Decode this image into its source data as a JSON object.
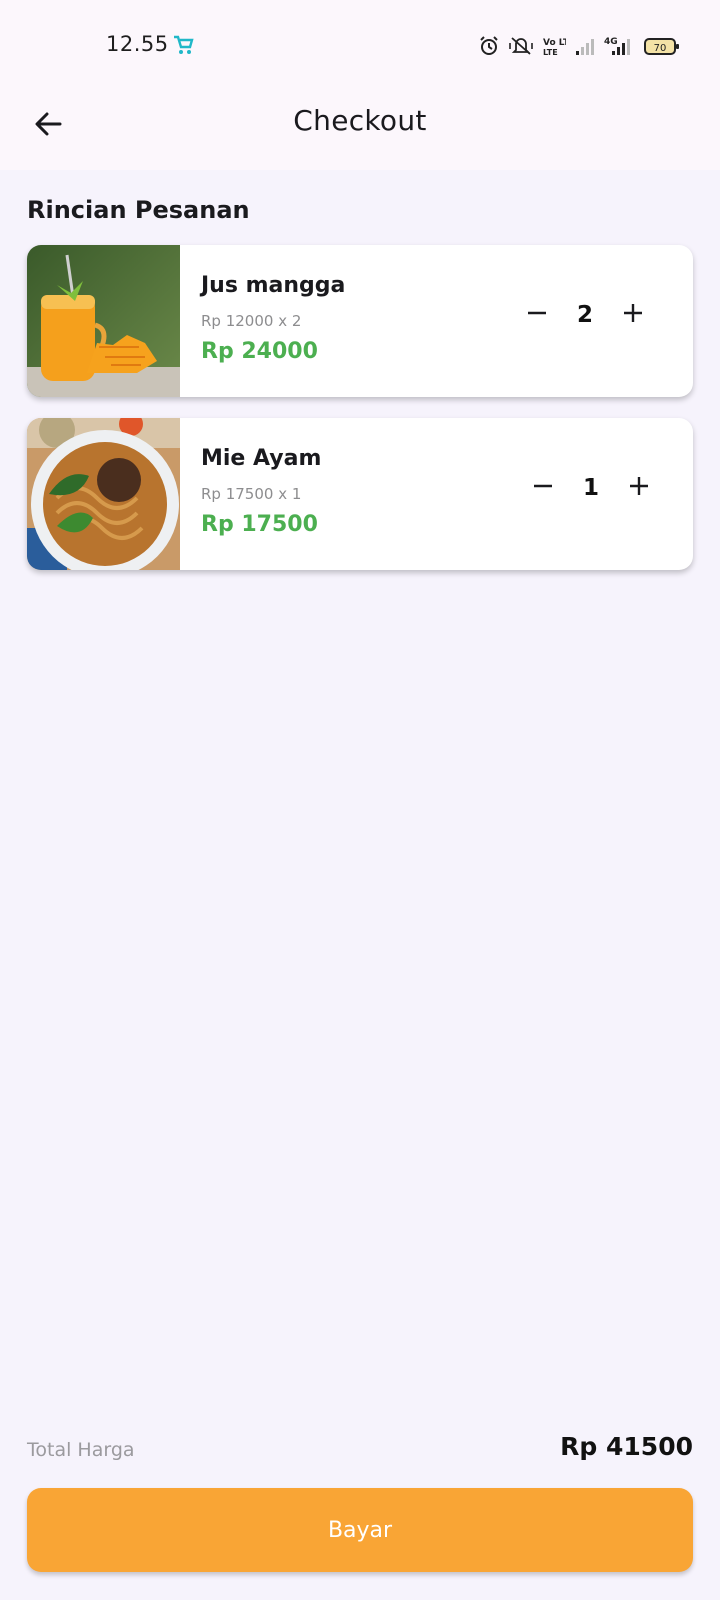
{
  "status_bar": {
    "time": "12.55",
    "battery": "70",
    "network": "4G",
    "volte": "Vo LTE",
    "icons": [
      "alarm-icon",
      "vibrate-off-icon",
      "volte-icon",
      "signal-icon",
      "signal-4g-icon",
      "battery-icon"
    ]
  },
  "appbar": {
    "title": "Checkout",
    "back_icon": "arrow-left-icon"
  },
  "section": {
    "title": "Rincian Pesanan"
  },
  "items": [
    {
      "name": "Jus mangga",
      "detail": "Rp 12000 x 2",
      "subtotal": "Rp 24000",
      "quantity": "2"
    },
    {
      "name": "Mie Ayam",
      "detail": "Rp 17500 x 1",
      "subtotal": "Rp 17500",
      "quantity": "1"
    }
  ],
  "summary": {
    "total_label": "Total Harga",
    "total_value": "Rp 41500"
  },
  "pay_button": {
    "label": "Bayar"
  },
  "colors": {
    "accent": "#f9a535",
    "price_green": "#4caf50",
    "background": "#f6f3fc"
  }
}
